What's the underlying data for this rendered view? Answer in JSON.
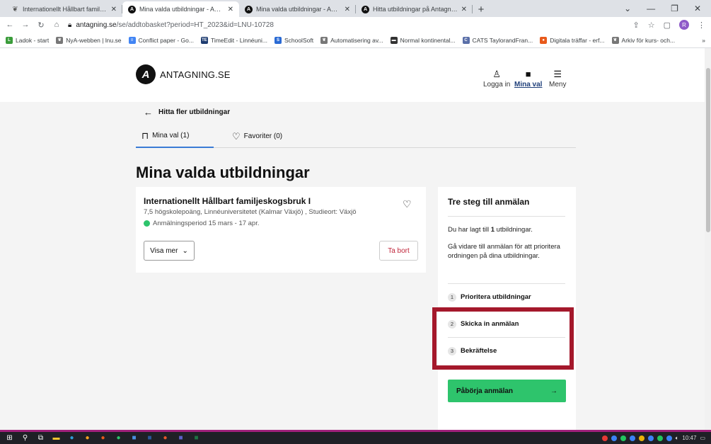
{
  "browser": {
    "tabs": [
      {
        "title": "Internationellt Hållbart familjeskog",
        "favicon": "tree-icon",
        "active": false
      },
      {
        "title": "Mina valda utbildningar - Antagn",
        "favicon": "antagning-icon",
        "active": true
      },
      {
        "title": "Mina valda utbildningar - Antagn",
        "favicon": "antagning-icon",
        "active": false
      },
      {
        "title": "Hitta utbildningar på Antagning",
        "favicon": "antagning-icon",
        "active": false
      }
    ],
    "new_tab": "+",
    "url_host": "antagning.se",
    "url_path": "/se/addtobasket?period=HT_2023&id=LNU-10728",
    "profile_initial": "R",
    "bookmarks": [
      {
        "label": "Ladok - start",
        "color": "#3a9c3a",
        "glyph": "L"
      },
      {
        "label": "NyA-webben | lnu.se",
        "color": "#777777",
        "glyph": "❦"
      },
      {
        "label": "Conflict paper - Go...",
        "color": "#4285f4",
        "glyph": "≡"
      },
      {
        "label": "TimeEdit - Linnéuni...",
        "color": "#1d3b70",
        "glyph": "TE"
      },
      {
        "label": "SchoolSoft",
        "color": "#2a6ad4",
        "glyph": "S"
      },
      {
        "label": "Automatisering av...",
        "color": "#777777",
        "glyph": "❦"
      },
      {
        "label": "Normal kontinental...",
        "color": "#333333",
        "glyph": "▬"
      },
      {
        "label": "CATS TaylorandFran...",
        "color": "#5a6fa8",
        "glyph": "C"
      },
      {
        "label": "Digitala träffar - erf...",
        "color": "#e85a1b",
        "glyph": "●"
      },
      {
        "label": "Arkiv för kurs- och...",
        "color": "#777777",
        "glyph": "❦"
      }
    ],
    "bookmarks_more": "»"
  },
  "site": {
    "logo_text": "ANTAGNING.SE",
    "nav": [
      {
        "label": "Logga in",
        "icon": "user-icon"
      },
      {
        "label": "Mina val",
        "icon": "basket-icon"
      },
      {
        "label": "Meny",
        "icon": "menu-icon"
      }
    ],
    "back_link": "Hitta fler utbildningar",
    "tabs": [
      {
        "label": "Mina val (1)",
        "icon": "bag-icon"
      },
      {
        "label": "Favoriter (0)",
        "icon": "heart-icon"
      }
    ],
    "heading": "Mina valda utbildningar"
  },
  "course": {
    "title": "Internationellt Hållbart familjeskogsbruk I",
    "meta": "7,5 högskolepoäng, Linnéuniversitetet (Kalmar Växjö) , Studieort: Växjö",
    "period": "Anmälningsperiod 15 mars - 17 apr.",
    "show_more": "Visa mer",
    "remove": "Ta bort"
  },
  "sidebar": {
    "title": "Tre steg till anmälan",
    "added_prefix": "Du har lagt till ",
    "added_count": "1",
    "added_suffix": " utbildningar.",
    "info": "Gå vidare till anmälan för att prioritera ordningen på dina utbildningar.",
    "steps": [
      {
        "num": "1",
        "label": "Prioritera utbildningar"
      },
      {
        "num": "2",
        "label": "Skicka in anmälan"
      },
      {
        "num": "3",
        "label": "Bekräftelse"
      }
    ],
    "start_button": "Påbörja anmälan"
  },
  "taskbar": {
    "time": "10:47"
  },
  "colors": {
    "accent_green": "#2ec46c",
    "highlight_red": "#a4182b",
    "remove_red": "#c0263b",
    "tab_underline": "#3a7bd5"
  }
}
